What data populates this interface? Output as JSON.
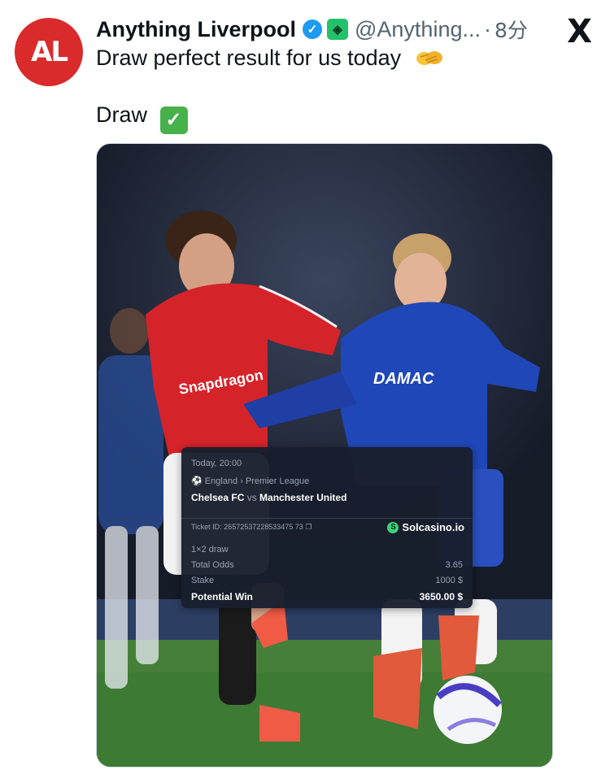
{
  "author": {
    "name": "Anything Liverpool",
    "handle": "@Anything...",
    "separator": "·",
    "time": "8分",
    "avatar_text": "AL",
    "avatar_color": "#d92b2b",
    "verified_icon": "verified-badge-icon",
    "affiliate_icon": "affiliate-badge-icon"
  },
  "platform_logo": "X",
  "tweet": {
    "line1": "Draw perfect result for us today",
    "line1_emoji": "handshake-emoji",
    "line2": "Draw",
    "line2_emoji": "check-mark-emoji"
  },
  "media": {
    "shirt_text_left": "Snapdragon",
    "shirt_text_right": "DAMAC",
    "bet_slip": {
      "time": "Today, 20:00",
      "competition_country": "England",
      "competition_sep": "›",
      "competition": "Premier League",
      "home": "Chelsea FC",
      "vs": "vs",
      "away": "Manchester United",
      "ticket_label": "Ticket ID:",
      "ticket_id": "26572537228533475 73",
      "brand": "Solcasino.io",
      "market": "1×2 draw",
      "odds_label": "Total Odds",
      "odds_value": "3.65",
      "stake_label": "Stake",
      "stake_value": "1000 $",
      "win_label": "Potential Win",
      "win_value": "3650.00 $"
    }
  }
}
